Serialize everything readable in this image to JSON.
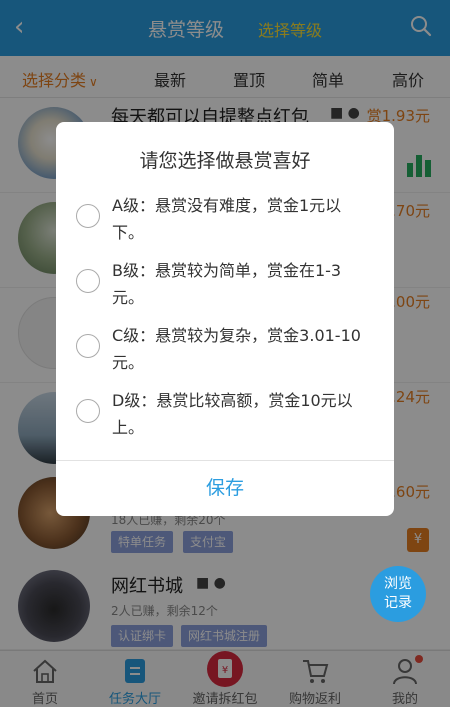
{
  "header": {
    "back_icon": "chevron-left-icon",
    "title": "悬赏等级",
    "subtitle": "选择等级",
    "search_icon": "search-icon"
  },
  "filters": [
    "选择分类",
    "最新",
    "置顶",
    "简单",
    "高价"
  ],
  "list": [
    {
      "title": "每天都可以自提整点红包",
      "reward": "赏1.93元",
      "meta": "",
      "tags": []
    },
    {
      "title": "",
      "reward": ".70元",
      "meta": "",
      "tags": []
    },
    {
      "title": "",
      "reward": ".00元",
      "meta": "",
      "tags": []
    },
    {
      "title": "",
      "reward": ".24元",
      "meta": "",
      "tags": []
    },
    {
      "title": "",
      "reward": ".60元",
      "meta": "18人已赚，剩余20个",
      "tags": [
        "特单任务",
        "支付宝"
      ]
    },
    {
      "title": "网红书城",
      "reward": "",
      "meta": "2人已赚，剩余12个",
      "tags": [
        "认证绑卡",
        "网红书城注册"
      ]
    }
  ],
  "dialog": {
    "title": "请您选择做悬赏喜好",
    "options": [
      {
        "line1": "A级：悬赏没有难度，赏金1元以",
        "line2": "下。",
        "selected": false
      },
      {
        "line1": "B级：悬赏较为简单，赏金在1-3",
        "line2": "元。",
        "selected": false
      },
      {
        "line1": "C级：悬赏较为复杂，赏金3.01-10",
        "line2": "元。",
        "selected": false
      },
      {
        "line1": "D级：悬赏比较高额，赏金10元以",
        "line2": "上。",
        "selected": false
      }
    ],
    "save_label": "保存"
  },
  "browse_button": {
    "line1": "浏览",
    "line2": "记录"
  },
  "tabs": [
    {
      "label": "首页",
      "icon": "home-icon"
    },
    {
      "label": "任务大厅",
      "icon": "task-hall-icon"
    },
    {
      "label": "邀请拆红包",
      "icon": "red-envelope-icon"
    },
    {
      "label": "购物返利",
      "icon": "shopping-cart-icon"
    },
    {
      "label": "我的",
      "icon": "user-icon"
    }
  ],
  "colors": {
    "primary": "#2b9de0",
    "accent_orange": "#e67e22",
    "header_sub": "#f8e03a",
    "tag_bg": "#8da0dd"
  }
}
